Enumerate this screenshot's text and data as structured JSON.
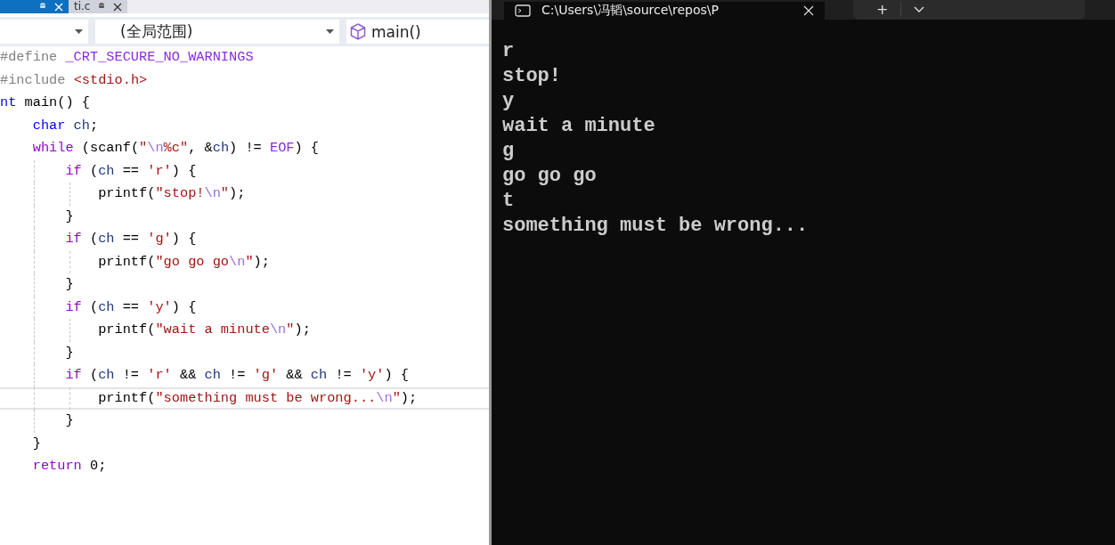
{
  "editor": {
    "tabs": [
      {
        "selected": true
      },
      {
        "label": "ti.c",
        "selected": false
      }
    ],
    "navbar": {
      "scope": "(全局范围)",
      "member": "main()"
    },
    "lines": [
      {
        "current": false,
        "tokens": [
          {
            "kind": "pp",
            "text": "#define "
          },
          {
            "kind": "macro",
            "text": "_CRT_SECURE_NO_WARNINGS"
          }
        ]
      },
      {
        "current": false,
        "tokens": [
          {
            "kind": "pp",
            "text": "#include "
          },
          {
            "kind": "str",
            "text": "<stdio.h>"
          }
        ]
      },
      {
        "current": false,
        "tokens": [
          {
            "kind": "type",
            "text": "nt"
          },
          {
            "kind": "plain",
            "text": " main() {"
          }
        ]
      },
      {
        "current": false,
        "tokens": [
          {
            "kind": "type",
            "text": "    char"
          },
          {
            "kind": "var",
            "text": " ch"
          },
          {
            "kind": "plain",
            "text": ";"
          }
        ]
      },
      {
        "current": false,
        "tokens": [
          {
            "kind": "kw",
            "text": "    while"
          },
          {
            "kind": "plain",
            "text": " (scanf("
          },
          {
            "kind": "str",
            "text": "\""
          },
          {
            "kind": "esc",
            "text": "\\n"
          },
          {
            "kind": "str",
            "text": "%c\""
          },
          {
            "kind": "plain",
            "text": ", &"
          },
          {
            "kind": "var",
            "text": "ch"
          },
          {
            "kind": "plain",
            "text": ") != "
          },
          {
            "kind": "macro",
            "text": "EOF"
          },
          {
            "kind": "plain",
            "text": ") {"
          }
        ]
      },
      {
        "current": false,
        "tokens": [
          {
            "kind": "kw",
            "text": "        if"
          },
          {
            "kind": "plain",
            "text": " ("
          },
          {
            "kind": "var",
            "text": "ch"
          },
          {
            "kind": "plain",
            "text": " == "
          },
          {
            "kind": "str",
            "text": "'r'"
          },
          {
            "kind": "plain",
            "text": ") {"
          }
        ]
      },
      {
        "current": false,
        "tokens": [
          {
            "kind": "plain",
            "text": "            printf("
          },
          {
            "kind": "str",
            "text": "\"stop!"
          },
          {
            "kind": "esc",
            "text": "\\n"
          },
          {
            "kind": "str",
            "text": "\""
          },
          {
            "kind": "plain",
            "text": ");"
          }
        ]
      },
      {
        "current": false,
        "tokens": [
          {
            "kind": "plain",
            "text": "        }"
          }
        ]
      },
      {
        "current": false,
        "tokens": [
          {
            "kind": "kw",
            "text": "        if"
          },
          {
            "kind": "plain",
            "text": " ("
          },
          {
            "kind": "var",
            "text": "ch"
          },
          {
            "kind": "plain",
            "text": " == "
          },
          {
            "kind": "str",
            "text": "'g'"
          },
          {
            "kind": "plain",
            "text": ") {"
          }
        ]
      },
      {
        "current": false,
        "tokens": [
          {
            "kind": "plain",
            "text": "            printf("
          },
          {
            "kind": "str",
            "text": "\"go go go"
          },
          {
            "kind": "esc",
            "text": "\\n"
          },
          {
            "kind": "str",
            "text": "\""
          },
          {
            "kind": "plain",
            "text": ");"
          }
        ]
      },
      {
        "current": false,
        "tokens": [
          {
            "kind": "plain",
            "text": "        }"
          }
        ]
      },
      {
        "current": false,
        "tokens": [
          {
            "kind": "kw",
            "text": "        if"
          },
          {
            "kind": "plain",
            "text": " ("
          },
          {
            "kind": "var",
            "text": "ch"
          },
          {
            "kind": "plain",
            "text": " == "
          },
          {
            "kind": "str",
            "text": "'y'"
          },
          {
            "kind": "plain",
            "text": ") {"
          }
        ]
      },
      {
        "current": false,
        "tokens": [
          {
            "kind": "plain",
            "text": "            printf("
          },
          {
            "kind": "str",
            "text": "\"wait a minute"
          },
          {
            "kind": "esc",
            "text": "\\n"
          },
          {
            "kind": "str",
            "text": "\""
          },
          {
            "kind": "plain",
            "text": ");"
          }
        ]
      },
      {
        "current": false,
        "tokens": [
          {
            "kind": "plain",
            "text": "        }"
          }
        ]
      },
      {
        "current": false,
        "tokens": [
          {
            "kind": "kw",
            "text": "        if"
          },
          {
            "kind": "plain",
            "text": " ("
          },
          {
            "kind": "var",
            "text": "ch"
          },
          {
            "kind": "plain",
            "text": " != "
          },
          {
            "kind": "str",
            "text": "'r'"
          },
          {
            "kind": "plain",
            "text": " && "
          },
          {
            "kind": "var",
            "text": "ch"
          },
          {
            "kind": "plain",
            "text": " != "
          },
          {
            "kind": "str",
            "text": "'g'"
          },
          {
            "kind": "plain",
            "text": " && "
          },
          {
            "kind": "var",
            "text": "ch"
          },
          {
            "kind": "plain",
            "text": " != "
          },
          {
            "kind": "str",
            "text": "'y'"
          },
          {
            "kind": "plain",
            "text": ") {"
          }
        ]
      },
      {
        "current": true,
        "tokens": [
          {
            "kind": "plain",
            "text": "            printf("
          },
          {
            "kind": "str",
            "text": "\"something must be wrong..."
          },
          {
            "kind": "esc",
            "text": "\\n"
          },
          {
            "kind": "str",
            "text": "\""
          },
          {
            "kind": "plain",
            "text": ");"
          }
        ]
      },
      {
        "current": false,
        "tokens": [
          {
            "kind": "plain",
            "text": "        }"
          }
        ]
      },
      {
        "current": false,
        "tokens": [
          {
            "kind": "plain",
            "text": "    }"
          }
        ]
      },
      {
        "current": false,
        "tokens": [
          {
            "kind": "kw",
            "text": "    return"
          },
          {
            "kind": "plain",
            "text": " 0;"
          }
        ]
      }
    ]
  },
  "terminal": {
    "tab_title": "C:\\Users\\冯韬\\source\\repos\\P",
    "new_tab": "+",
    "output": [
      "r",
      "stop!",
      "y",
      "wait a minute",
      "g",
      "go go go",
      "t",
      "something must be wrong..."
    ]
  }
}
